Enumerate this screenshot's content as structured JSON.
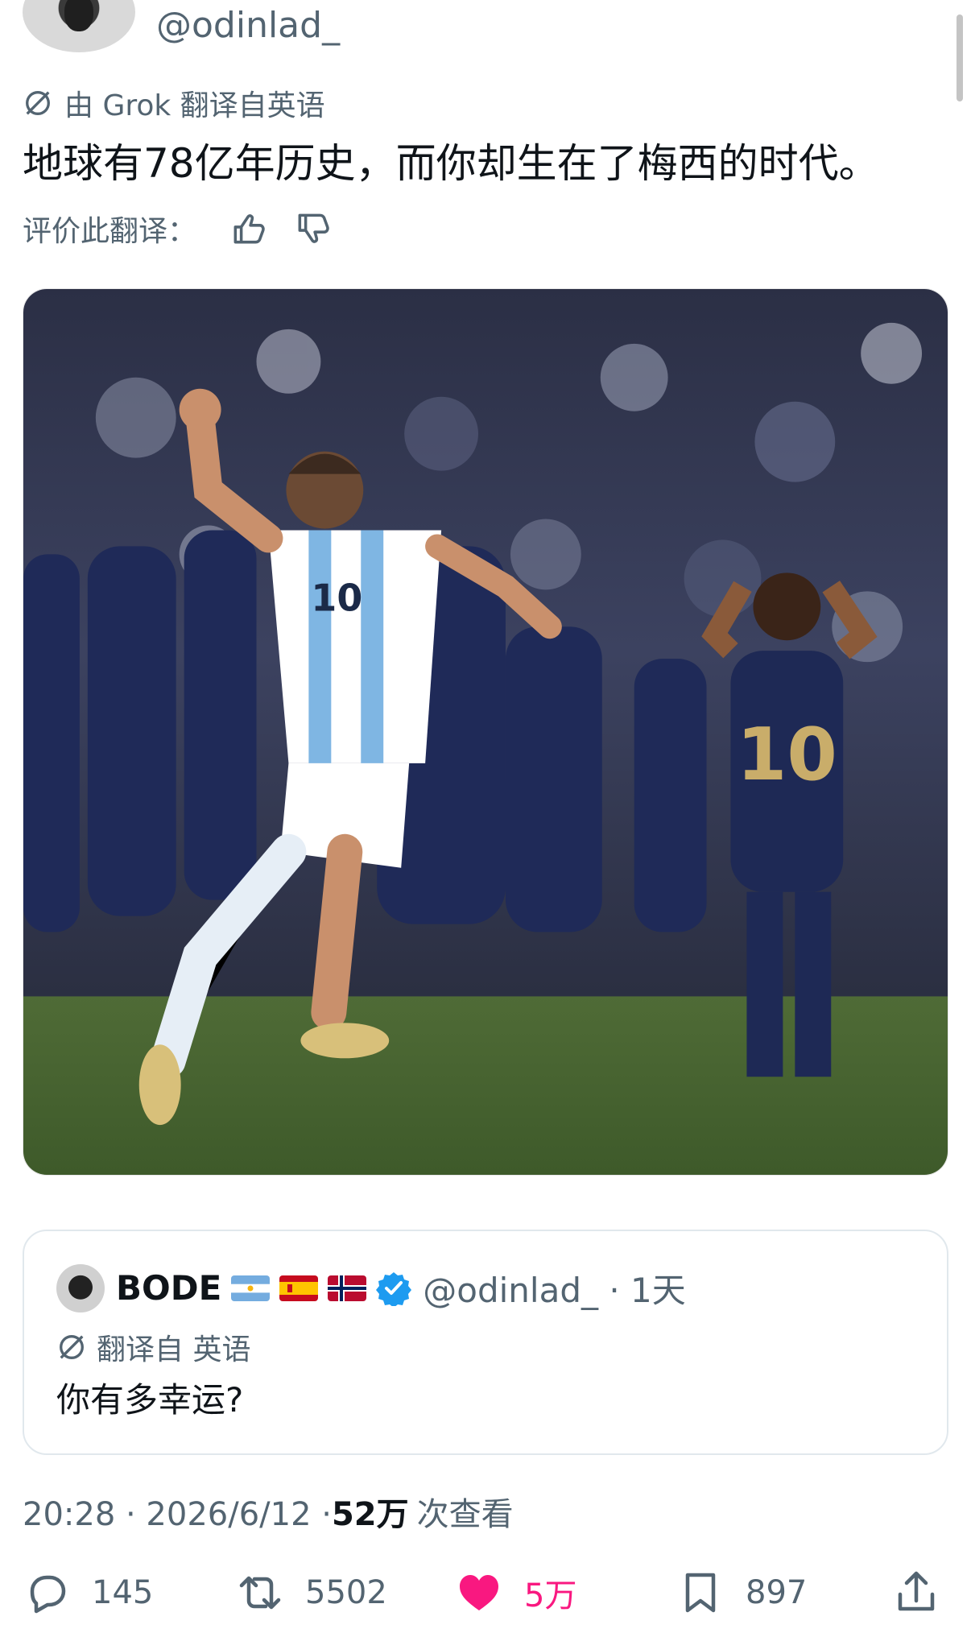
{
  "tweet": {
    "handle": "@odinlad_",
    "translated_by": "由 Grok 翻译自英语",
    "text": "地球有78亿年历史，而你却生在了梅西的时代。",
    "rate_label": "评价此翻译："
  },
  "quote": {
    "name": "BODE",
    "handle_time": "@odinlad_ · 1天",
    "translated_from": "翻译自 英语",
    "text": "你有多幸运?"
  },
  "meta": {
    "time_date": "20:28 · 2026/6/12 · ",
    "views_num": "52万",
    "views_label": "次查看"
  },
  "actions": {
    "replies": "145",
    "retweets": "5502",
    "likes": "5万",
    "bookmarks": "897"
  },
  "colors": {
    "text": "#0f1419",
    "secondary": "#536471",
    "like": "#f91880",
    "verified": "#1d9bf0"
  },
  "icons": [
    "grok-icon",
    "thumbs-up-icon",
    "thumbs-down-icon",
    "verified-badge-icon",
    "reply-icon",
    "retweet-icon",
    "heart-icon",
    "bookmark-icon",
    "share-icon"
  ]
}
